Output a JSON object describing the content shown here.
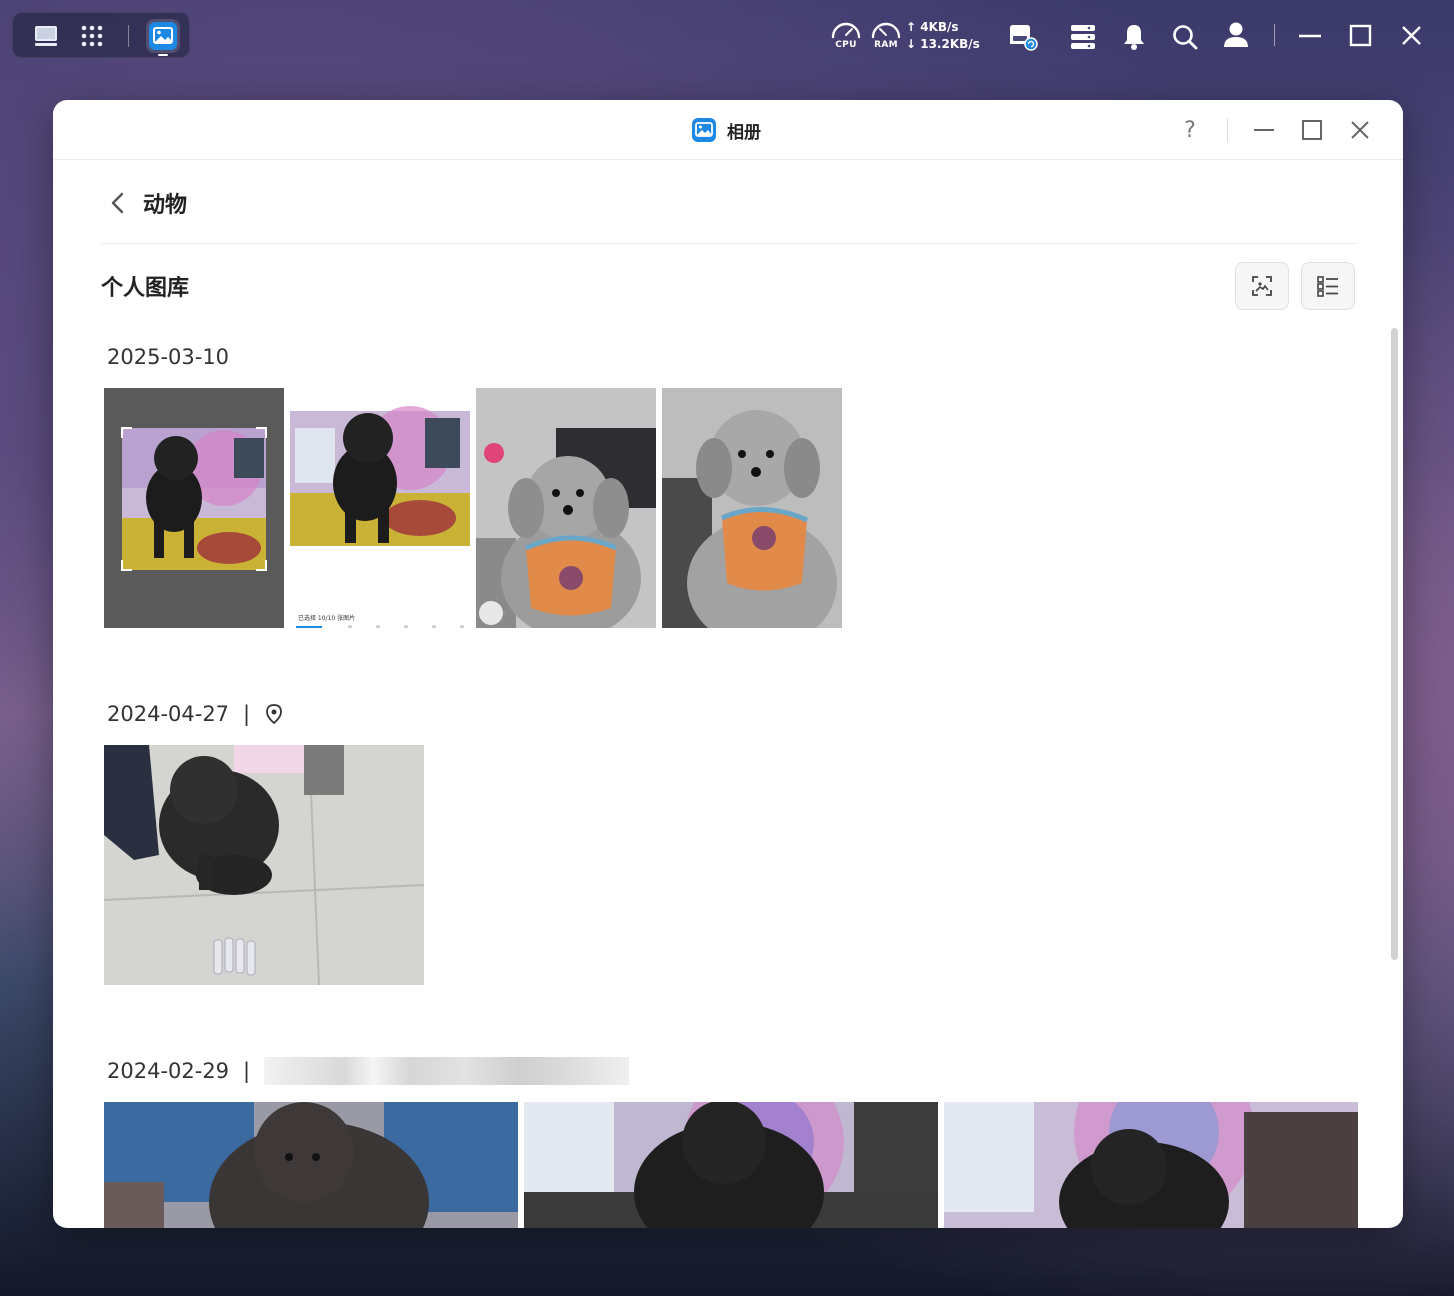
{
  "taskbar": {
    "cpu_label": "CPU",
    "ram_label": "RAM",
    "upload_speed": "↑ 4KB/s",
    "download_speed": "↓ 13.2KB/s"
  },
  "window": {
    "app_title": "相册",
    "help_label": "?"
  },
  "header": {
    "title": "动物"
  },
  "library": {
    "title": "个人图库"
  },
  "groups": [
    {
      "date": "2025-03-10",
      "photo_count": 4
    },
    {
      "date": "2024-04-27",
      "separator": "|",
      "photo_count": 1
    },
    {
      "date": "2024-02-29",
      "separator": "|",
      "photo_count": 3
    }
  ],
  "photo_overlays": {
    "screenshot_caption": "已选择 10/10 张图片"
  },
  "colors": {
    "accent_blue": "#1e88e5",
    "scrollbar": "#d2d2d2"
  }
}
